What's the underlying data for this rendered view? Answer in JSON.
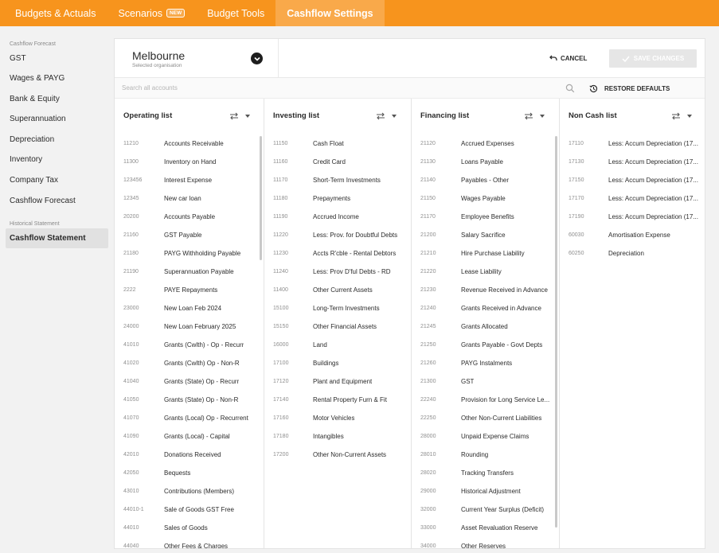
{
  "nav": {
    "tabs": [
      {
        "label": "Budgets & Actuals"
      },
      {
        "label": "Scenarios",
        "badge": "NEW"
      },
      {
        "label": "Budget Tools"
      },
      {
        "label": "Cashflow Settings"
      }
    ]
  },
  "sidebar": {
    "section1": "Cashflow Forecast",
    "items": [
      {
        "label": "GST"
      },
      {
        "label": "Wages & PAYG"
      },
      {
        "label": "Bank & Equity"
      },
      {
        "label": "Superannuation"
      },
      {
        "label": "Depreciation"
      },
      {
        "label": "Inventory"
      },
      {
        "label": "Company Tax"
      },
      {
        "label": "Cashflow Forecast"
      }
    ],
    "section2": "Historical Statement",
    "active_item": "Cashflow Statement"
  },
  "org": {
    "name": "Melbourne",
    "subtitle": "Selected organisation"
  },
  "actions": {
    "cancel": "CANCEL",
    "save": "SAVE CHANGES",
    "restore": "RESTORE DEFAULTS"
  },
  "search": {
    "placeholder": "Search all accounts"
  },
  "columns": [
    {
      "title": "Operating list",
      "rows": [
        [
          "11210",
          "Accounts Receivable"
        ],
        [
          "11300",
          "Inventory on Hand"
        ],
        [
          "123456",
          "Interest Expense"
        ],
        [
          "12345",
          "New car loan"
        ],
        [
          "20200",
          "Accounts Payable"
        ],
        [
          "21160",
          "GST Payable"
        ],
        [
          "21180",
          "PAYG Withholding Payable"
        ],
        [
          "21190",
          "Superannuation Payable"
        ],
        [
          "2222",
          "PAYE Repayments"
        ],
        [
          "23000",
          "New Loan Feb 2024"
        ],
        [
          "24000",
          "New Loan February 2025"
        ],
        [
          "41010",
          "Grants (Cwlth) - Op - Recurr"
        ],
        [
          "41020",
          "Grants (Cwlth) Op - Non-R"
        ],
        [
          "41040",
          "Grants (State) Op - Recurr"
        ],
        [
          "41050",
          "Grants (State) Op - Non-R"
        ],
        [
          "41070",
          "Grants (Local) Op - Recurrent"
        ],
        [
          "41090",
          "Grants (Local) - Capital"
        ],
        [
          "42010",
          "Donations Received"
        ],
        [
          "42050",
          "Bequests"
        ],
        [
          "43010",
          "Contributions (Members)"
        ],
        [
          "44010-1",
          "Sale of Goods GST Free"
        ],
        [
          "44010",
          "Sales of Goods"
        ],
        [
          "44040",
          "Other Fees & Charges"
        ]
      ]
    },
    {
      "title": "Investing list",
      "rows": [
        [
          "11150",
          "Cash Float"
        ],
        [
          "11160",
          "Credit Card"
        ],
        [
          "11170",
          "Short-Term Investments"
        ],
        [
          "11180",
          "Prepayments"
        ],
        [
          "11190",
          "Accrued Income"
        ],
        [
          "11220",
          "Less: Prov. for Doubtful Debts"
        ],
        [
          "11230",
          "Accts R'cble - Rental Debtors"
        ],
        [
          "11240",
          "Less: Prov D'ful Debts - RD"
        ],
        [
          "11400",
          "Other Current Assets"
        ],
        [
          "15100",
          "Long-Term Investments"
        ],
        [
          "15150",
          "Other Financial Assets"
        ],
        [
          "16000",
          "Land"
        ],
        [
          "17100",
          "Buildings"
        ],
        [
          "17120",
          "Plant and Equipment"
        ],
        [
          "17140",
          "Rental Property Furn & Fit"
        ],
        [
          "17160",
          "Motor Vehicles"
        ],
        [
          "17180",
          "Intangibles"
        ],
        [
          "17200",
          "Other Non-Current Assets"
        ]
      ]
    },
    {
      "title": "Financing list",
      "rows": [
        [
          "21120",
          "Accrued Expenses"
        ],
        [
          "21130",
          "Loans Payable"
        ],
        [
          "21140",
          "Payables - Other"
        ],
        [
          "21150",
          "Wages Payable"
        ],
        [
          "21170",
          "Employee Benefits"
        ],
        [
          "21200",
          "Salary Sacrifice"
        ],
        [
          "21210",
          "Hire Purchase Liability"
        ],
        [
          "21220",
          "Lease Liability"
        ],
        [
          "21230",
          "Revenue Received in Advance"
        ],
        [
          "21240",
          "Grants Received in Advance"
        ],
        [
          "21245",
          "Grants Allocated"
        ],
        [
          "21250",
          "Grants Payable - Govt Depts"
        ],
        [
          "21260",
          "PAYG Instalments"
        ],
        [
          "21300",
          "GST"
        ],
        [
          "22240",
          "Provision for Long Service Le..."
        ],
        [
          "22250",
          "Other Non-Current Liabilities"
        ],
        [
          "28000",
          "Unpaid Expense Claims"
        ],
        [
          "28010",
          "Rounding"
        ],
        [
          "28020",
          "Tracking Transfers"
        ],
        [
          "29000",
          "Historical Adjustment"
        ],
        [
          "32000",
          "Current Year Surplus (Deficit)"
        ],
        [
          "33000",
          "Asset Revaluation Reserve"
        ],
        [
          "34000",
          "Other Reserves"
        ]
      ]
    },
    {
      "title": "Non Cash list",
      "rows": [
        [
          "17110",
          "Less: Accum Depreciation (17..."
        ],
        [
          "17130",
          "Less: Accum Depreciation (17..."
        ],
        [
          "17150",
          "Less: Accum Depreciation (17..."
        ],
        [
          "17170",
          "Less: Accum Depreciation (17..."
        ],
        [
          "17190",
          "Less: Accum Depreciation (17..."
        ],
        [
          "60030",
          "Amortisation Expense"
        ],
        [
          "60250",
          "Depreciation"
        ]
      ]
    }
  ],
  "colors": {
    "brand": "#f7941d",
    "brand_active": "#f9a94a"
  }
}
